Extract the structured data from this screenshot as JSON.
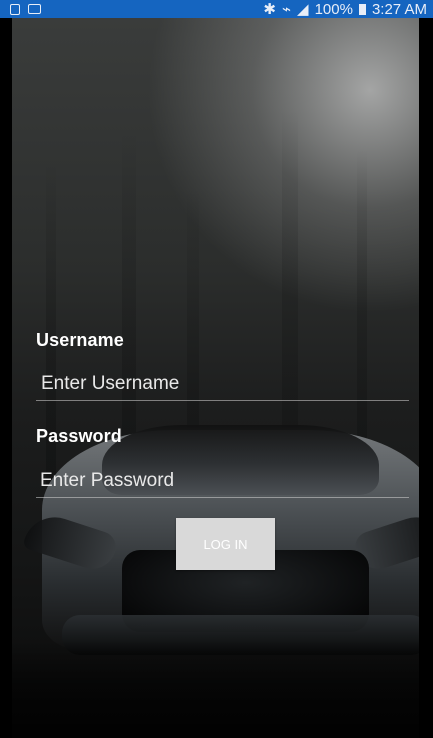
{
  "status_bar": {
    "battery_percent": "100%",
    "time": "3:27 AM",
    "icons": [
      "notification-icon",
      "image-icon",
      "bluetooth-icon",
      "vibrate-icon",
      "signal-icon",
      "battery-icon"
    ]
  },
  "form": {
    "username_label": "Username",
    "username_placeholder": "Enter Username",
    "password_label": "Password",
    "password_placeholder": "Enter Password",
    "login_button_label": "LOG IN"
  },
  "colors": {
    "status_bar_bg": "#1565c0",
    "button_bg": "#d9d9d9"
  }
}
